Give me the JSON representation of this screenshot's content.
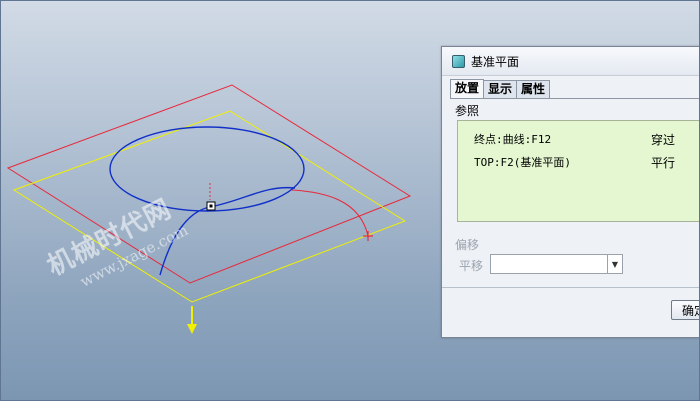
{
  "watermark": {
    "line1": "机械时代网",
    "line2": "www.jxage.com"
  },
  "dialog": {
    "title": "基准平面",
    "tabs": [
      {
        "label": "放置"
      },
      {
        "label": "显示"
      },
      {
        "label": "属性"
      }
    ],
    "references_label": "参照",
    "references": [
      {
        "name": "终点:曲线:F12",
        "constraint": "穿过"
      },
      {
        "name": "TOP:F2(基准平面)",
        "constraint": "平行"
      }
    ],
    "offset_label": "偏移",
    "translate_label": "平移",
    "translate_value": "",
    "ok_label": "确定"
  },
  "colors": {
    "datum_plane_red": "#e8283a",
    "datum_plane_yellow": "#f0f000",
    "curve_blue": "#1030c8",
    "reference_green_bg": "#e4f7d0"
  }
}
